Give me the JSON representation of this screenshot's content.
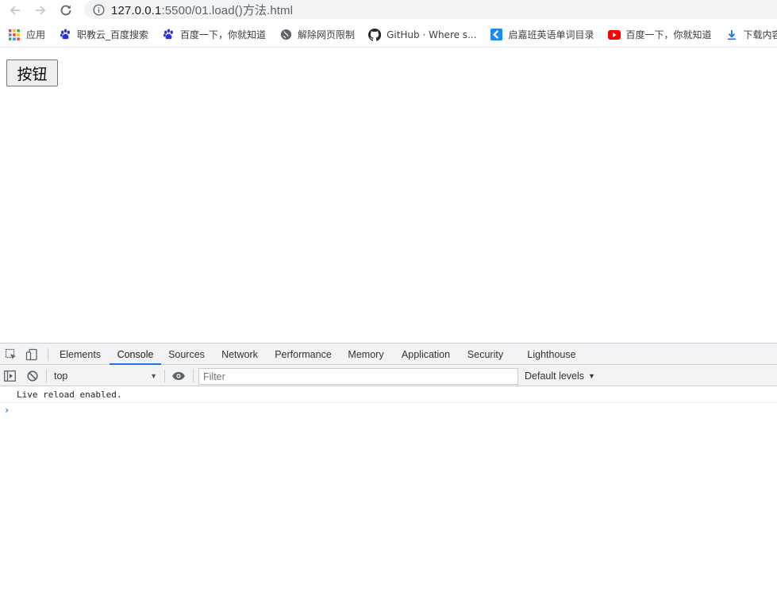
{
  "browser": {
    "url_host": "127.0.0.1",
    "url_path": ":5500/01.load()方法.html"
  },
  "bookmarks": [
    {
      "label": "应用",
      "icon": "apps-grid-icon"
    },
    {
      "label": "职教云_百度搜索",
      "icon": "baidu-paw-icon"
    },
    {
      "label": "百度一下，你就知道",
      "icon": "baidu-paw-icon"
    },
    {
      "label": "解除网页限制",
      "icon": "globe-icon"
    },
    {
      "label": "GitHub · Where s...",
      "icon": "github-icon"
    },
    {
      "label": "启嘉班英语单词目录",
      "icon": "chevron-logo-icon"
    },
    {
      "label": "百度一下，你就知道",
      "icon": "youtube-play-icon"
    },
    {
      "label": "下载内容",
      "icon": "download-icon"
    }
  ],
  "page": {
    "button_label": "按钮"
  },
  "devtools": {
    "tabs": [
      "Elements",
      "Console",
      "Sources",
      "Network",
      "Performance",
      "Memory",
      "Application",
      "Security",
      "Lighthouse"
    ],
    "active_tab": "Console",
    "context": "top",
    "filter_placeholder": "Filter",
    "levels_label": "Default levels",
    "messages": [
      "Live reload enabled."
    ],
    "prompt": "›"
  },
  "colors": {
    "active_tab_underline": "#1a73e8",
    "prompt": "#1a73e8"
  }
}
